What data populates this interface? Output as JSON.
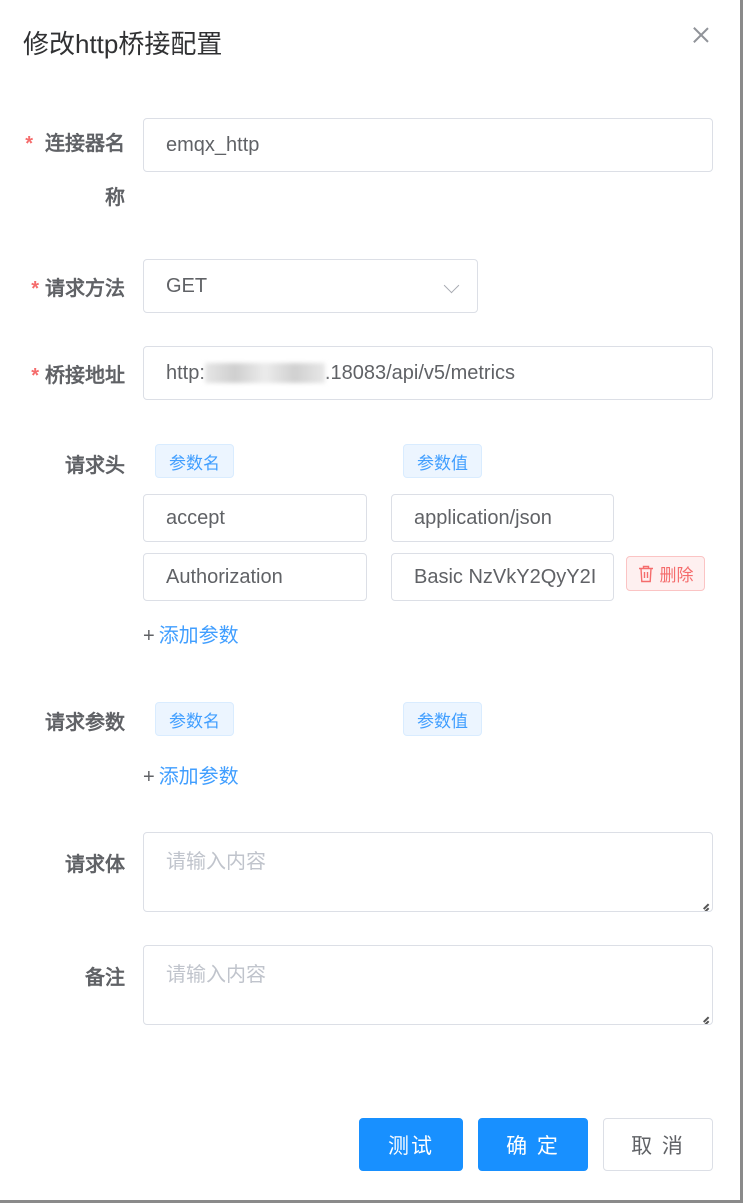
{
  "dialog": {
    "title": "修改http桥接配置"
  },
  "form": {
    "name": {
      "label": "连接器名称",
      "value": "emqx_http",
      "required_mark": "*"
    },
    "method": {
      "label": "请求方法",
      "value": "GET",
      "required_mark": "*"
    },
    "url": {
      "label": "桥接地址",
      "prefix": "http:",
      "suffix": ".18083/api/v5/metrics",
      "required_mark": "*"
    },
    "headers": {
      "label": "请求头",
      "col_name": "参数名",
      "col_value": "参数值",
      "rows": [
        {
          "name": "accept",
          "value": "application/json"
        },
        {
          "name": "Authorization",
          "value": "Basic NzVkY2QyY2I"
        }
      ],
      "delete_label": "删除",
      "add_label": "添加参数",
      "add_prefix": "+"
    },
    "params": {
      "label": "请求参数",
      "col_name": "参数名",
      "col_value": "参数值",
      "add_label": "添加参数",
      "add_prefix": "+"
    },
    "body": {
      "label": "请求体",
      "placeholder": "请输入内容"
    },
    "remark": {
      "label": "备注",
      "placeholder": "请输入内容"
    }
  },
  "footer": {
    "test_label": "测试",
    "confirm_label": "确 定",
    "cancel_label": "取 消"
  },
  "colors": {
    "primary": "#1890ff",
    "danger": "#f56c6c",
    "tag_blue": "#409eff"
  }
}
